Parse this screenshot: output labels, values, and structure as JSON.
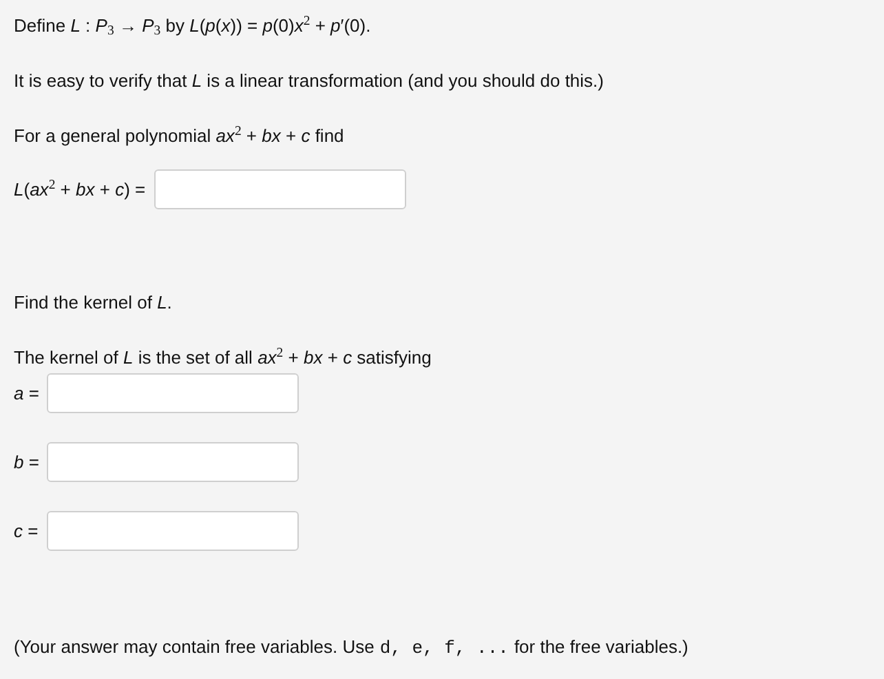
{
  "intro": "Define *L* : *P*$_{3}$ → *P*$_{3}$ by *L*(*p*(*x*)) = *p*(0)*x*$^{2}$ + *p*′(0).",
  "hint": "It is easy to verify that *L* is a linear transformation (and you should do this.)",
  "prompt": "For a general polynomial *ax*$^{2}$ + *bx* + *c* find",
  "image_field": {
    "label": "*L*(*ax*$^{2}$ + *bx* + *c*) ="
  },
  "kernel_prompt": "Find the kernel of *L*.",
  "kernel_text": "The kernel of *L* is the set of all *ax*$^{2}$ + *bx* + *c* satisfying",
  "kernel_fields": [
    {
      "label": "*a* ="
    },
    {
      "label": "*b* ="
    },
    {
      "label": "*c* ="
    }
  ],
  "note": {
    "before": "(Your answer may contain free variables. Use",
    "code": "d, e, f, ...",
    "after": "for the free variables.)"
  }
}
